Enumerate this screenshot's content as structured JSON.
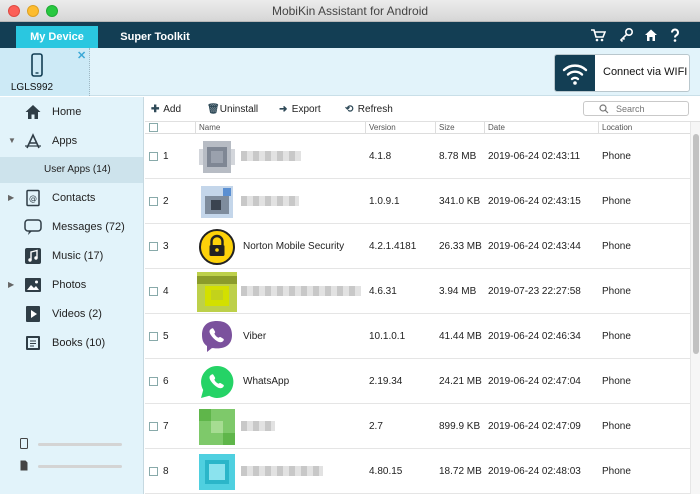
{
  "window": {
    "title": "MobiKin Assistant for Android"
  },
  "tabs": [
    {
      "label": "My Device"
    },
    {
      "label": "Super Toolkit"
    }
  ],
  "toolbar_icons": [
    "cart-icon",
    "key-icon",
    "home-icon",
    "help-icon"
  ],
  "device": {
    "name": "LGLS992",
    "wifi_label": "Connect via WIFI"
  },
  "sidebar": {
    "items": [
      {
        "label": "Home",
        "icon": "home-icon"
      },
      {
        "label": "Apps",
        "icon": "apps-icon"
      },
      {
        "label": "Contacts",
        "icon": "contacts-icon"
      },
      {
        "label": "Messages (72)",
        "icon": "messages-icon"
      },
      {
        "label": "Music (17)",
        "icon": "music-icon"
      },
      {
        "label": "Photos",
        "icon": "photos-icon"
      },
      {
        "label": "Videos (2)",
        "icon": "videos-icon"
      },
      {
        "label": "Books (10)",
        "icon": "books-icon"
      }
    ],
    "sub_item": "User Apps (14)"
  },
  "actions": {
    "add": "Add",
    "uninstall": "Uninstall",
    "export": "Export",
    "refresh": "Refresh"
  },
  "search": {
    "placeholder": "Search"
  },
  "table": {
    "columns": {
      "name": "Name",
      "version": "Version",
      "size": "Size",
      "date": "Date",
      "location": "Location"
    },
    "rows": [
      {
        "num": "1",
        "name": "",
        "version": "4.1.8",
        "size": "8.78 MB",
        "date": "2019-06-24 02:43:11",
        "location": "Phone",
        "icon": "blurred-app-icon"
      },
      {
        "num": "2",
        "name": "",
        "version": "1.0.9.1",
        "size": "341.0 KB",
        "date": "2019-06-24 02:43:15",
        "location": "Phone",
        "icon": "blurred-app-icon"
      },
      {
        "num": "3",
        "name": "Norton Mobile Security",
        "version": "4.2.1.4181",
        "size": "26.33 MB",
        "date": "2019-06-24 02:43:44",
        "location": "Phone",
        "icon": "norton-lock-icon"
      },
      {
        "num": "4",
        "name": "",
        "version": "4.6.31",
        "size": "3.94 MB",
        "date": "2019-07-23 22:27:58",
        "location": "Phone",
        "icon": "blurred-app-icon"
      },
      {
        "num": "5",
        "name": "Viber",
        "version": "10.1.0.1",
        "size": "41.44 MB",
        "date": "2019-06-24 02:46:34",
        "location": "Phone",
        "icon": "viber-icon"
      },
      {
        "num": "6",
        "name": "WhatsApp",
        "version": "2.19.34",
        "size": "24.21 MB",
        "date": "2019-06-24 02:47:04",
        "location": "Phone",
        "icon": "whatsapp-icon"
      },
      {
        "num": "7",
        "name": "",
        "version": "2.7",
        "size": "899.9 KB",
        "date": "2019-06-24 02:47:09",
        "location": "Phone",
        "icon": "blurred-app-icon"
      },
      {
        "num": "8",
        "name": "",
        "version": "4.80.15",
        "size": "18.72 MB",
        "date": "2019-06-24 02:48:03",
        "location": "Phone",
        "icon": "blurred-app-icon"
      }
    ]
  },
  "colors": {
    "tab_bar": "#133e54",
    "tab_active": "#2ac7e0",
    "sidebar_bg": "#e2f3fa"
  }
}
